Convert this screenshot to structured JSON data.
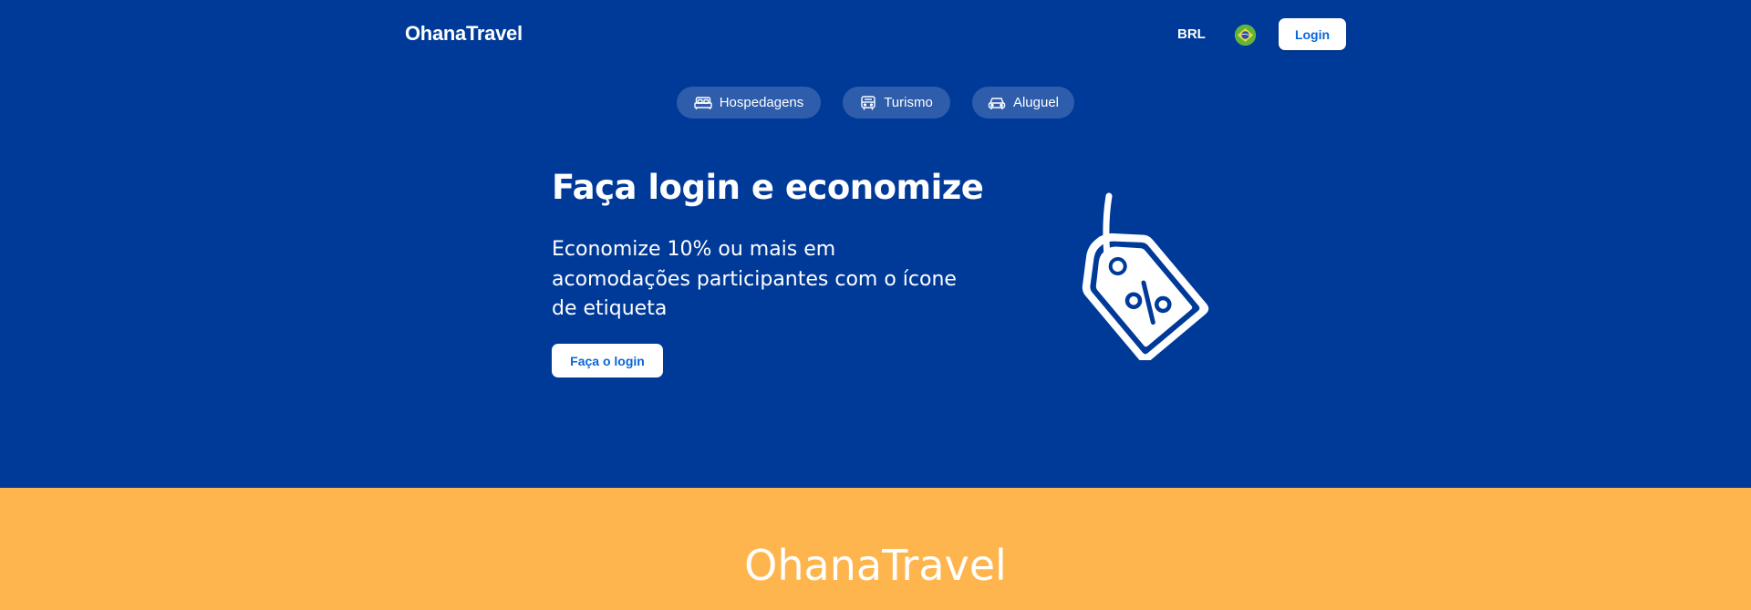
{
  "header": {
    "brand": "OhanaTravel",
    "currency": "BRL",
    "flag_icon": "brazil-flag-icon",
    "login_label": "Login"
  },
  "nav": {
    "tabs": [
      {
        "label": "Hospedagens",
        "icon": "bed-icon"
      },
      {
        "label": "Turismo",
        "icon": "bus-icon"
      },
      {
        "label": "Aluguel",
        "icon": "car-icon"
      }
    ]
  },
  "promo": {
    "title": "Faça login e economize",
    "description": "Economize 10% ou mais em acomodações participantes com o ícone de etiqueta",
    "cta_label": "Faça o login",
    "illustration_icon": "discount-tag-icon"
  },
  "footer": {
    "brand": "OhanaTravel"
  },
  "colors": {
    "primary": "#003a99",
    "accent": "#ffb54d",
    "button_text": "#0a66d9",
    "white": "#ffffff"
  }
}
